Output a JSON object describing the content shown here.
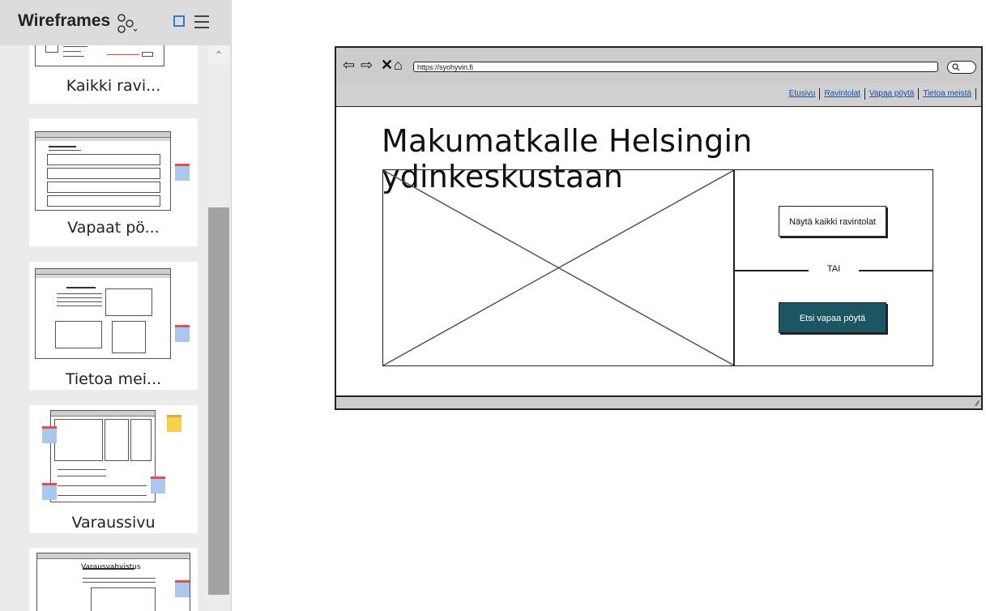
{
  "panel": {
    "title": "Wireframes",
    "icons": [
      "share-icon",
      "single-page-icon",
      "menu-icon"
    ],
    "cards": [
      {
        "label": "Kaikki ravi..."
      },
      {
        "label": "Vapaat pö..."
      },
      {
        "label": "Tietoa mei..."
      },
      {
        "label": "Varaussivu"
      },
      {
        "label": "Varausvahvistus"
      }
    ]
  },
  "wireframe": {
    "url": "https://syohyvin.fi",
    "nav": {
      "links": [
        "Etusivu",
        "Ravintolat",
        "Vapaa pöytä",
        "Tietoa meistä"
      ]
    },
    "headline": "Makumatkalle Helsingin ydinkeskustaan",
    "btn_all": "Näytä kaikki ravintolat",
    "separator": "TAI",
    "btn_search": "Etsi vapaa pöytä"
  },
  "colors": {
    "accent_button": "#1d5663",
    "link": "#1a4ea6",
    "panel_bg": "#ebebeb"
  }
}
